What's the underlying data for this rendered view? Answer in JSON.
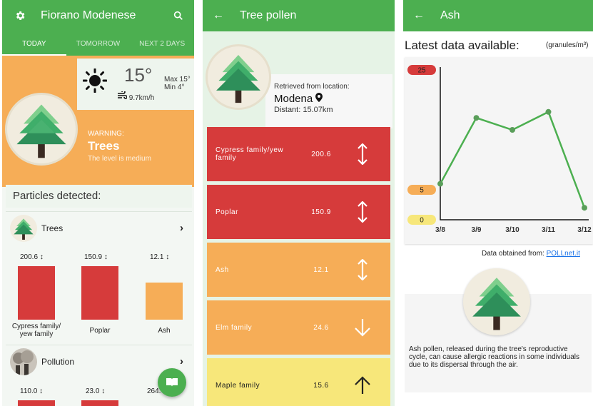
{
  "screen1": {
    "app_title": "Fiorano Modenese",
    "tabs": [
      "TODAY",
      "TOMORROW",
      "NEXT 2 DAYS"
    ],
    "weather": {
      "temp": "15°",
      "max": "Max 15°",
      "min": "Min 4°",
      "wind": "9.7km/h"
    },
    "warning": {
      "label": "WARNING:",
      "group": "Trees",
      "level": "The level is medium"
    },
    "particles_heading": "Particles detected:",
    "trees_group": {
      "label": "Trees",
      "bars": [
        {
          "value": "200.6",
          "label": "Cypress family/ yew family",
          "color": "#d63b3b"
        },
        {
          "value": "150.9",
          "label": "Poplar",
          "color": "#d63b3b"
        },
        {
          "value": "12.1",
          "label": "Ash",
          "color": "#f6ad57"
        }
      ]
    },
    "pollution_group": {
      "label": "Pollution",
      "values": [
        "110.0",
        "23.0",
        "264."
      ]
    }
  },
  "screen2": {
    "title": "Tree pollen",
    "location": {
      "retrieved_label": "Retrieved from location:",
      "city": "Modena",
      "distance": "Distant: 15.07km"
    },
    "pollens": [
      {
        "name": "Cypress family/yew family",
        "value": "200.6",
        "trend": "updown",
        "color": "#d63b3b",
        "text_color": "#ffffff"
      },
      {
        "name": "Poplar",
        "value": "150.9",
        "trend": "updown",
        "color": "#d63b3b",
        "text_color": "#ffffff"
      },
      {
        "name": "Ash",
        "value": "12.1",
        "trend": "updown",
        "color": "#f6ad57",
        "text_color": "#ffffff"
      },
      {
        "name": "Elm family",
        "value": "24.6",
        "trend": "down",
        "color": "#f6ad57",
        "text_color": "#ffffff"
      },
      {
        "name": "Maple family",
        "value": "15.6",
        "trend": "up",
        "color": "#f7e77a",
        "text_color": "#222222"
      }
    ]
  },
  "screen3": {
    "title": "Ash",
    "latest_label": "Latest data available:",
    "unit": "(granules/m³)",
    "source_label": "Data obtained from:",
    "source_link": "POLLnet.it",
    "description": "Ash pollen, released during the tree's reproductive cycle, can cause allergic reactions in some individuals due to its dispersal through the air."
  },
  "chart_data": {
    "type": "line",
    "x": [
      "3/8",
      "3/9",
      "3/10",
      "3/11",
      "3/12"
    ],
    "series": [
      {
        "values": [
          6,
          17,
          15,
          18,
          2
        ]
      }
    ],
    "y_tags": [
      {
        "label": "25",
        "value": 25,
        "color": "#d63b3b"
      },
      {
        "label": "5",
        "value": 5,
        "color": "#f6ad57"
      },
      {
        "label": "0",
        "value": 0,
        "color": "#f7e77a"
      }
    ],
    "ylim": [
      0,
      25
    ],
    "line_color": "#4caf50"
  }
}
